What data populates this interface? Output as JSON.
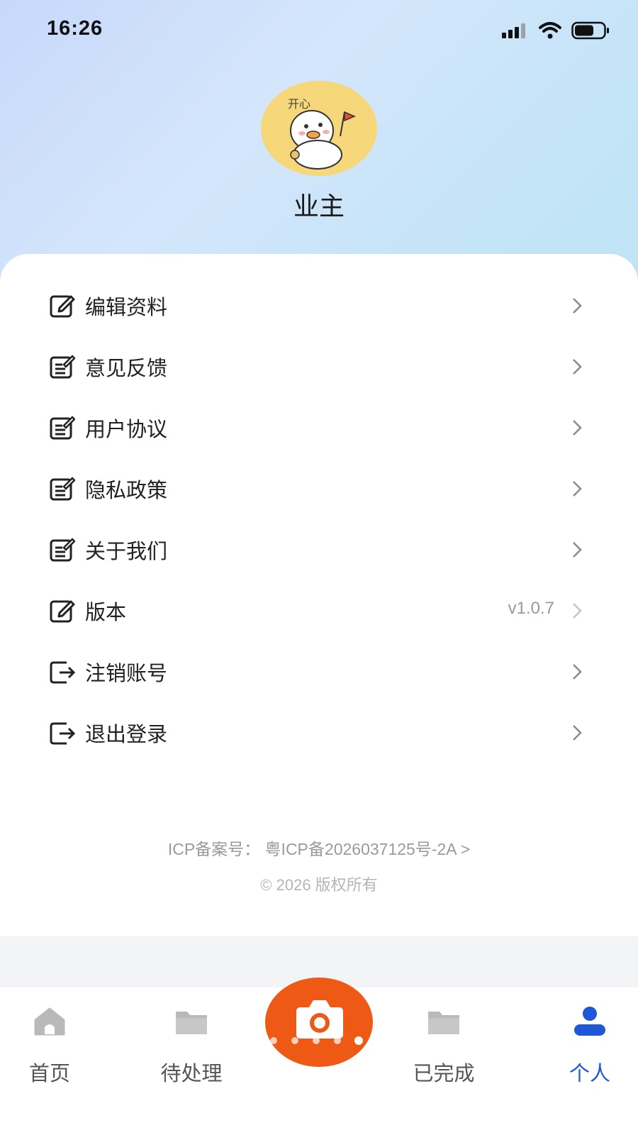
{
  "status_bar": {
    "time": "16:26"
  },
  "profile": {
    "name": "业主",
    "avatar_caption": "开心"
  },
  "menu": [
    {
      "label": "编辑资料",
      "icon": "edit-icon",
      "value": ""
    },
    {
      "label": "意见反馈",
      "icon": "document-edit-icon",
      "value": ""
    },
    {
      "label": "用户协议",
      "icon": "document-edit-icon",
      "value": ""
    },
    {
      "label": "隐私政策",
      "icon": "document-edit-icon",
      "value": ""
    },
    {
      "label": "关于我们",
      "icon": "document-edit-icon",
      "value": ""
    },
    {
      "label": "版本",
      "icon": "edit-icon",
      "value": "v1.0.7"
    },
    {
      "label": "注销账号",
      "icon": "exit-icon",
      "value": ""
    },
    {
      "label": "退出登录",
      "icon": "exit-icon",
      "value": ""
    }
  ],
  "footer": {
    "icp": "ICP备案号：  粤ICP备2026037125号-2A >",
    "copyright": "© 2026 版权所有"
  },
  "tabbar": {
    "home": "首页",
    "pending": "待处理",
    "completed": "已完成",
    "profile": "个人"
  },
  "colors": {
    "accent": "#1f57d6",
    "camera": "#ee5a16",
    "avatar_bg": "#f6d77a"
  }
}
